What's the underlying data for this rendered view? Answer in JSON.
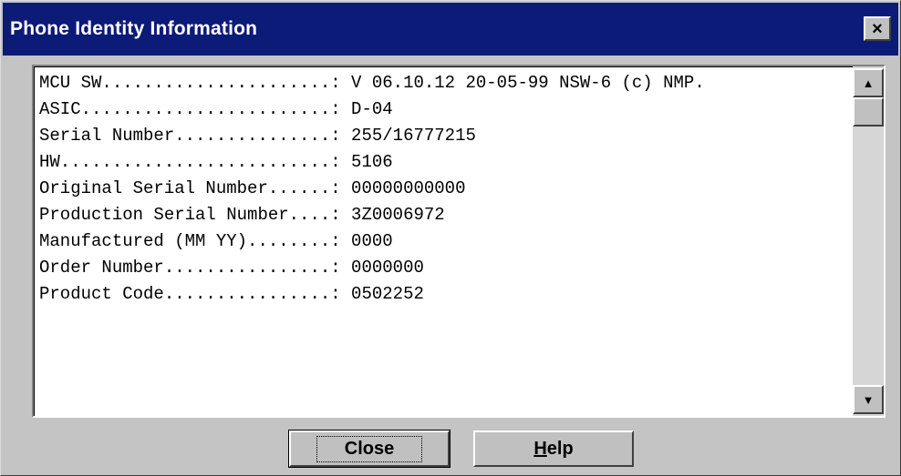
{
  "window": {
    "title": "Phone Identity Information",
    "close_glyph": "×"
  },
  "info_lines": [
    "MCU SW......................: V 06.10.12 20-05-99 NSW-6 (c) NMP.",
    "ASIC........................: D-04",
    "Serial Number...............: 255/16777215",
    "HW..........................: 5106",
    "Original Serial Number......: 00000000000",
    "Production Serial Number....: 3Z0006972",
    "Manufactured (MM YY)........: 0000",
    "Order Number................: 0000000",
    "Product Code................: 0502252"
  ],
  "scrollbar": {
    "up_icon": "triangle-up-icon",
    "down_icon": "triangle-down-icon",
    "up_glyph": "▲",
    "down_glyph": "▼"
  },
  "buttons": {
    "close_label": "Close",
    "help_mnemonic": "H",
    "help_rest": "elp"
  }
}
